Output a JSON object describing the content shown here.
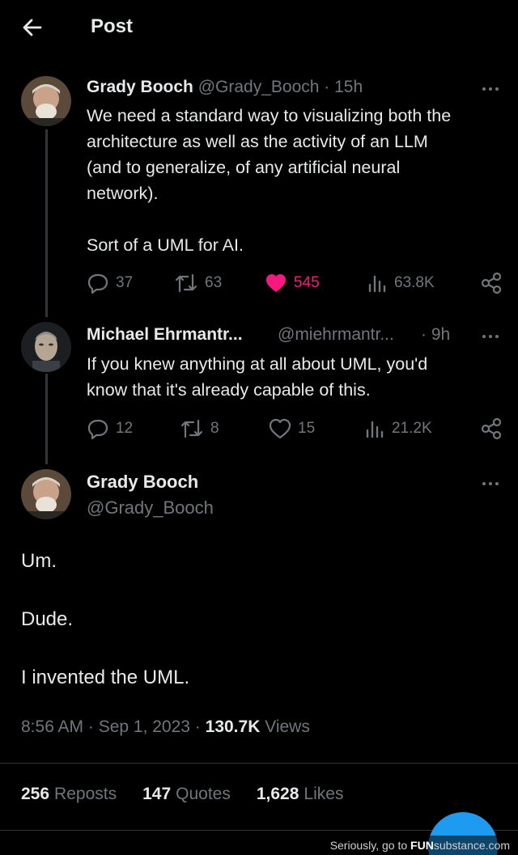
{
  "header": {
    "title": "Post"
  },
  "tweets": [
    {
      "name": "Grady Booch",
      "handle": "@Grady_Booch",
      "time": "· 15h",
      "text": "We need a standard way to visualizing both the\narchitecture as well as the activity of an LLM\n(and to generalize, of any artificial neural\nnetwork).\n\nSort of a UML for AI.",
      "replies": "37",
      "reposts": "63",
      "likes": "545",
      "views": "63.8K"
    },
    {
      "name": "Michael Ehrmantr...",
      "handle": "@miehrmantr...",
      "time": "· 9h",
      "text": "If you knew anything at all about UML, you'd\nknow that it's already capable of this.",
      "replies": "12",
      "reposts": "8",
      "likes": "15",
      "views": "21.2K"
    }
  ],
  "main": {
    "name": "Grady Booch",
    "handle": "@Grady_Booch",
    "text": "Um.\n\nDude.\n\nI invented the UML.",
    "time": "8:56 AM · Sep 1, 2023 · ",
    "views_count": "130.7K",
    "views_label": " Views"
  },
  "stats": {
    "reposts_count": "256",
    "reposts_label": "Reposts",
    "quotes_count": "147",
    "quotes_label": "Quotes",
    "likes_count": "1,628",
    "likes_label": "Likes"
  },
  "watermark": {
    "prefix": "Seriously, go to ",
    "brand": "FUN",
    "brand_rest": "substance.com"
  },
  "colors": {
    "background": "#000000",
    "text": "#e7e9ea",
    "muted": "#71767b",
    "like": "#f91880",
    "accent": "#1d9bf0"
  },
  "icons": [
    "back-arrow-icon",
    "more-icon",
    "reply-icon",
    "repost-icon",
    "like-icon",
    "views-icon",
    "share-icon"
  ]
}
